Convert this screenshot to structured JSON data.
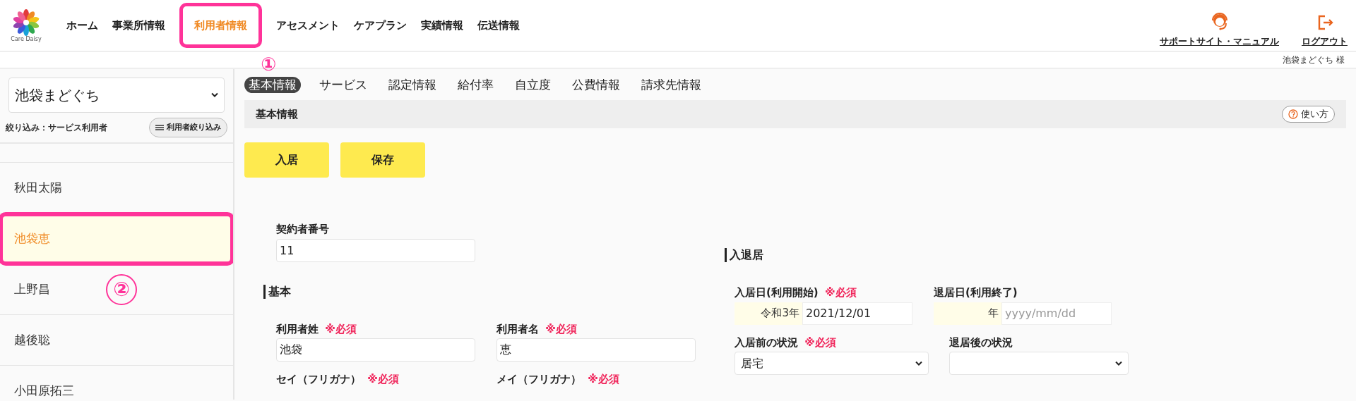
{
  "header": {
    "logo_text": "Care Daisy",
    "nav": [
      {
        "label": "ホーム",
        "selected": false
      },
      {
        "label": "事業所情報",
        "selected": false
      },
      {
        "label": "利用者情報",
        "selected": true,
        "callout": "①"
      },
      {
        "label": "アセスメント",
        "selected": false
      },
      {
        "label": "ケアプラン",
        "selected": false
      },
      {
        "label": "実績情報",
        "selected": false
      },
      {
        "label": "伝送情報",
        "selected": false
      }
    ],
    "support_link": "サポートサイト・マニュアル",
    "logout_link": "ログアウト",
    "user_greeting": "池袋まどぐち 様"
  },
  "sidebar": {
    "office_select": "池袋まどぐち",
    "filter_label": "絞り込み：サービス利用者",
    "filter_button": "利用者絞り込み",
    "users": [
      {
        "name": "秋田太陽",
        "selected": false
      },
      {
        "name": "池袋恵",
        "selected": true,
        "callout": "②"
      },
      {
        "name": "上野昌",
        "selected": false
      },
      {
        "name": "越後聡",
        "selected": false
      },
      {
        "name": "小田原拓三",
        "selected": false
      }
    ]
  },
  "tabs": [
    {
      "label": "基本情報",
      "selected": true
    },
    {
      "label": "サービス",
      "selected": false
    },
    {
      "label": "認定情報",
      "selected": false
    },
    {
      "label": "給付率",
      "selected": false
    },
    {
      "label": "自立度",
      "selected": false
    },
    {
      "label": "公費情報",
      "selected": false
    },
    {
      "label": "請求先情報",
      "selected": false
    }
  ],
  "panel": {
    "title": "基本情報",
    "help_button": "使い方",
    "actions": [
      "入居",
      "保存"
    ],
    "contract_number": {
      "label": "契約者番号",
      "value": "11"
    },
    "basic": {
      "title": "基本",
      "fields": [
        {
          "kind": "text",
          "label": "利用者姓",
          "required_mark": "※必須",
          "value": "池袋"
        },
        {
          "kind": "text",
          "label": "利用者名",
          "required_mark": "※必須",
          "value": "恵"
        },
        {
          "kind": "label",
          "label": "セイ（フリガナ）",
          "required_mark": "※必須"
        },
        {
          "kind": "label",
          "label": "メイ（フリガナ）",
          "required_mark": "※必須"
        }
      ]
    },
    "move": {
      "title": "入退居",
      "fields": [
        {
          "kind": "date",
          "label": "入居日(利用開始)",
          "required_mark": "※必須",
          "era": "令和3年",
          "value": "2021/12/01"
        },
        {
          "kind": "date",
          "label": "退居日(利用終了)",
          "era": "年",
          "placeholder": "yyyy/mm/dd"
        },
        {
          "kind": "select",
          "label": "入居前の状況",
          "required_mark": "※必須",
          "value": "居宅"
        },
        {
          "kind": "select",
          "label": "退居後の状況"
        }
      ]
    }
  }
}
